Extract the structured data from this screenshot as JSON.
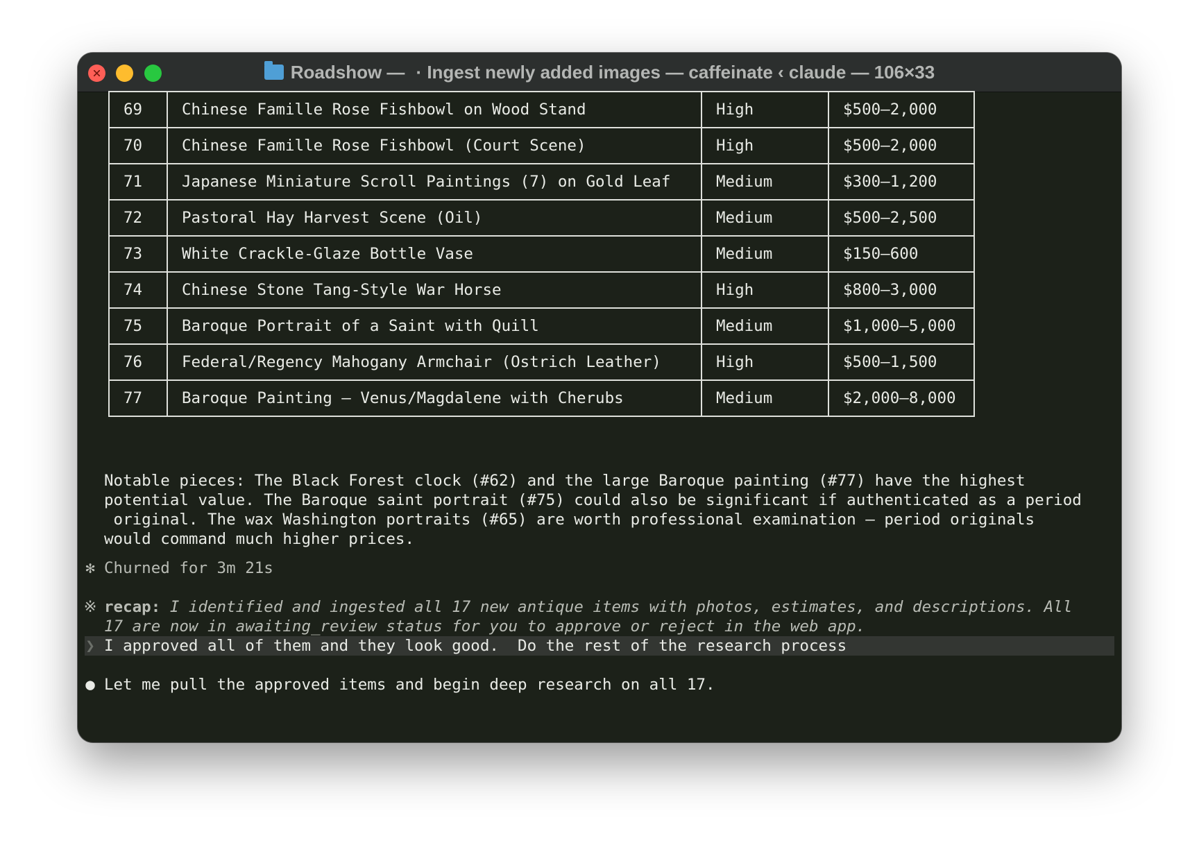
{
  "window": {
    "title_app": "Roadshow —",
    "title_rest": "· Ingest newly added images — caffeinate ‹ claude — 106×33"
  },
  "table": {
    "rows": [
      {
        "num": "69",
        "item": "Chinese Famille Rose Fishbowl on Wood Stand",
        "confidence": "High",
        "value": "$500–2,000"
      },
      {
        "num": "70",
        "item": "Chinese Famille Rose Fishbowl (Court Scene)",
        "confidence": "High",
        "value": "$500–2,000"
      },
      {
        "num": "71",
        "item": "Japanese Miniature Scroll Paintings (7) on Gold Leaf",
        "confidence": "Medium",
        "value": "$300–1,200"
      },
      {
        "num": "72",
        "item": "Pastoral Hay Harvest Scene (Oil)",
        "confidence": "Medium",
        "value": "$500–2,500"
      },
      {
        "num": "73",
        "item": "White Crackle-Glaze Bottle Vase",
        "confidence": "Medium",
        "value": "$150–600"
      },
      {
        "num": "74",
        "item": "Chinese Stone Tang-Style War Horse",
        "confidence": "High",
        "value": "$800–3,000"
      },
      {
        "num": "75",
        "item": "Baroque Portrait of a Saint with Quill",
        "confidence": "Medium",
        "value": "$1,000–5,000"
      },
      {
        "num": "76",
        "item": "Federal/Regency Mahogany Armchair (Ostrich Leather)",
        "confidence": "High",
        "value": "$500–1,500"
      },
      {
        "num": "77",
        "item": "Baroque Painting — Venus/Magdalene with Cherubs",
        "confidence": "Medium",
        "value": "$2,000–8,000"
      }
    ]
  },
  "notes": {
    "line1": "Notable pieces: The Black Forest clock (#62) and the large Baroque painting (#77) have the highest",
    "line2": "potential value. The Baroque saint portrait (#75) could also be significant if authenticated as a period",
    "line3": " original. The wax Washington portraits (#65) are worth professional examination — period originals",
    "line4": "would command much higher prices."
  },
  "status": {
    "churn_symbol": "✻",
    "churn_text": "Churned for 3m 21s"
  },
  "recap": {
    "symbol": "※",
    "label": "recap:",
    "line1": " I identified and ingested all 17 new antique items with photos, estimates, and descriptions. All",
    "line2": "17 are now in awaiting_review status for you to approve or reject in the web app."
  },
  "prompt": {
    "symbol": "❯",
    "text": "I approved all of them and they look good.  Do the rest of the research process"
  },
  "response": {
    "symbol": "●",
    "text": "Let me pull the approved items and begin deep research on all 17."
  },
  "colors": {
    "terminal_bg": "#1c2119",
    "text": "#e9ebe6",
    "titlebar": "#2c2f2e"
  }
}
